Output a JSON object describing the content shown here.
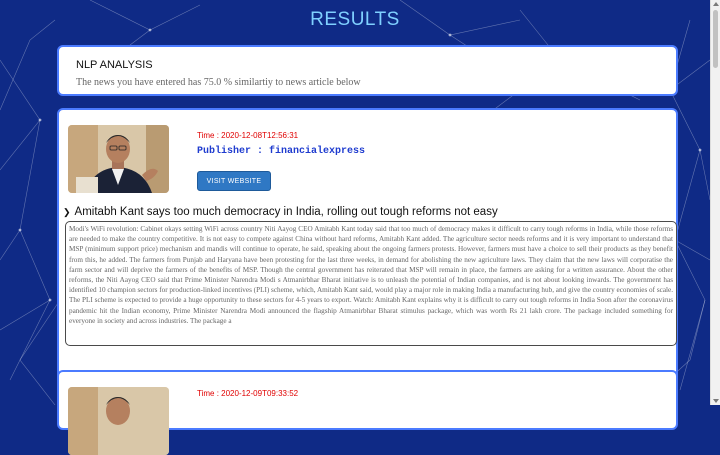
{
  "page": {
    "title": "RESULTS"
  },
  "nlp": {
    "title": "NLP ANALYSIS",
    "similarity_text": "The news you have entered has 75.0 % similartiy to news article below"
  },
  "articles": [
    {
      "time": "Time : 2020-12-08T12:56:31",
      "publisher": "Publisher : financialexpress",
      "button_label": "VISIT WEBSITE",
      "headline": "Amitabh Kant says too much democracy in India, rolling out tough reforms not easy",
      "body": "Modi's WiFi revolution: Cabinet okays setting WiFi across country Niti Aayog CEO Amitabh Kant today said that too much of democracy makes it difficult to carry tough reforms in India, while those reforms are needed to make the country competitive. It is not easy to compete against China without hard reforms, Amitabh Kant added. The agriculture sector needs reforms and it is very important to understand that MSP (minimum support price) mechanism and mandis will continue to operate, he said, speaking about the ongoing farmers protests. However, farmers must have a choice to sell their products as they benefit from this, he added. The farmers from Punjab and Haryana have been protesting for the last three weeks, in demand for abolishing the new agriculture laws. They claim that the new laws will corporatise the farm sector and will deprive the farmers of the benefits of MSP. Though the central government has reiterated that MSP will remain in place, the farmers are asking for a written assurance. About the other reforms, the Niti Aayog CEO said that Prime Minister Narendra Modi s Atmanirbhar Bharat initiative is to unleash the potential of Indian companies, and is not about looking inwards. The government has identified 10 champion sectors for production-linked incentives (PLI) scheme, which, Amitabh Kant said, would play a major role in making India a manufacturing hub, and give the country economies of scale. The PLI scheme is expected to provide a huge opportunity to these sectors for 4-5 years to export. Watch: Amitabh Kant explains why it is difficult to carry out tough reforms in India Soon after the coronavirus pandemic hit the Indian economy, Prime Minister Narendra Modi announced the flagship Atmanirbhar Bharat stimulus package, which was worth Rs 21 lakh crore. The package included something for everyone in society and across industries. The package a"
    },
    {
      "time": "Time : 2020-12-09T09:33:52"
    }
  ],
  "colors": {
    "background": "#0f2a86",
    "title": "#7fd0ff",
    "card_border": "#4b7bff",
    "time": "#e00000",
    "publisher": "#1f3ccf",
    "button": "#2f78c4"
  }
}
